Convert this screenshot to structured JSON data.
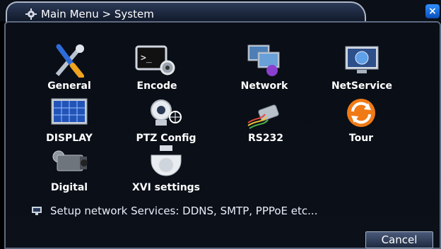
{
  "window": {
    "title": "Main Menu > System",
    "close_glyph": "×"
  },
  "items": [
    {
      "label": "General",
      "icon": "tools-icon"
    },
    {
      "label": "Encode",
      "icon": "terminal-gear-icon"
    },
    {
      "label": "Network",
      "icon": "monitors-network-icon"
    },
    {
      "label": "NetService",
      "icon": "globe-monitor-icon"
    },
    {
      "label": "DISPLAY",
      "icon": "display-grid-icon"
    },
    {
      "label": "PTZ Config",
      "icon": "ptz-camera-icon"
    },
    {
      "label": "RS232",
      "icon": "serial-cable-icon"
    },
    {
      "label": "Tour",
      "icon": "refresh-icon"
    },
    {
      "label": "Digital",
      "icon": "ip-camera-icon"
    },
    {
      "label": "XVI settings",
      "icon": "dome-camera-icon"
    }
  ],
  "hint": {
    "text": "Setup network Services: DDNS, SMTP, PPPoE etc..."
  },
  "footer": {
    "cancel_label": "Cancel"
  }
}
